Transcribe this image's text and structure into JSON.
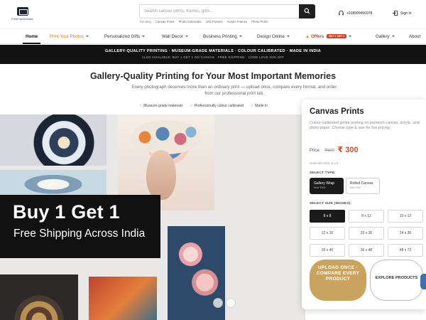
{
  "logo": {
    "wordmark": "PrintFramesIndia"
  },
  "search": {
    "placeholder": "Search canvas prints, frames, gifts..."
  },
  "trending": {
    "label": "Trending",
    "items": [
      "Canvas Prints",
      "Photo Calendars",
      "LED Frames",
      "Acrylic Frames",
      "Photo Prints"
    ]
  },
  "header": {
    "phone": "+918999456978",
    "signin": "Sign In"
  },
  "nav": {
    "items": [
      "Home",
      "Print Your Photos",
      "Personalized Gifts",
      "Wall Decor",
      "Business Printing",
      "Design Online",
      "Offers",
      "Gallery",
      "About"
    ],
    "offer_badge": "BUY 1 GET 1"
  },
  "banner": {
    "line1": "GALLERY-QUALITY PRINTING · MUSEUM-GRADE MATERIALS · COLOUR CALIBRATED · MADE IN INDIA",
    "line2": "ALSO AVAILABLE: BUY 1 GET 1 ON CANVAS · FREE SHIPPING · CODE LOVE 40% OFF"
  },
  "intro": {
    "headline": "Gallery-Quality Printing for Your Most Important Memories",
    "subtext": "Every photograph deserves more than an ordinary print — upload once, compare every format, and order from our professional print lab.",
    "features": [
      "Museum-grade materials",
      "Professionally colour calibrated",
      "Made in"
    ]
  },
  "promo": {
    "big": "Buy 1 Get 1",
    "small": "Free Shipping Across India"
  },
  "product": {
    "title": "Canvas Prints",
    "description": "Colour-calibrated giclée printing on premium canvas, acrylic, and photo paper. Choose type & size for live pricing.",
    "price_label": "Price:",
    "old_price": "₹600",
    "new_price": "₹ 300",
    "selected_size_text": "Selected Size: 8 x 8",
    "type_label": "SELECT TYPE:",
    "types": [
      {
        "name": "Gallery Wrap",
        "sub": "from ₹300",
        "selected": true
      },
      {
        "name": "Rolled Canvas",
        "sub": "from ₹63",
        "selected": false
      }
    ],
    "size_label": "SELECT SIZE (INCHES):",
    "sizes": [
      "8 x 8",
      "8 x 12",
      "10 x 12",
      "12 x 16",
      "20 x 30",
      "24 x 36",
      "30 x 40",
      "36 x 48",
      "48 x 72"
    ],
    "selected_size": "8 x 8",
    "upload_label": "UPLOAD ONCE · COMPARE EVERY PRODUCT",
    "explore_label": "EXPLORE PRODUCTS"
  },
  "colors": {
    "accent_gold": "#c9a45f",
    "price_red": "#d14b26",
    "nav_orange": "#c9781f",
    "offer_red": "#d6402a"
  }
}
